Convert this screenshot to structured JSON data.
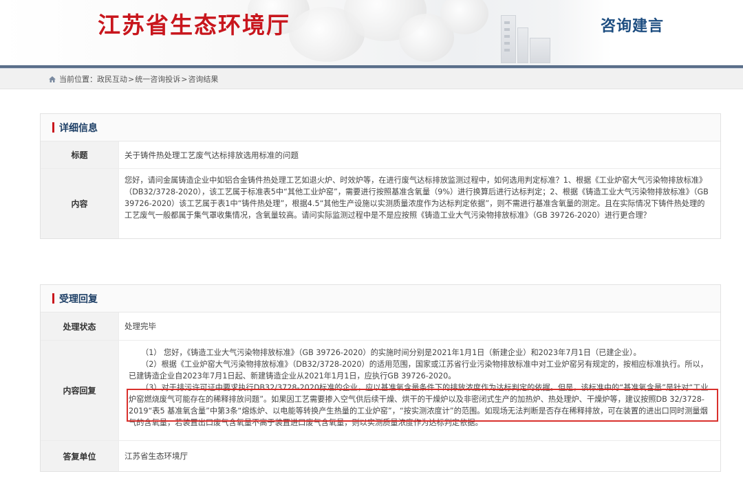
{
  "header": {
    "site_title": "江苏省生态环境厅",
    "section_name": "咨询建言"
  },
  "breadcrumb": {
    "prefix": "当前位置：",
    "items": [
      "政民互动",
      "统一咨询投诉",
      "咨询结果"
    ],
    "separator": ">"
  },
  "details": {
    "heading": "详细信息",
    "title_label": "标题",
    "title_value": "关于铸件热处理工艺废气达标排放选用标准的问题",
    "content_label": "内容",
    "content_value": "您好，请问金属铸造企业中如铝合金铸件热处理工艺如退火炉、时效炉等，在进行废气达标排放监测过程中，如何选用判定标准？1、根据《工业炉窑大气污染物排放标准》（DB32/3728-2020），该工艺属于标准表5中“其他工业炉窑”，需要进行按照基准含氧量（9%）进行换算后进行达标判定；2、根据《铸造工业大气污染物排放标准》（GB 39726-2020）该工艺属于表1中“铸件热处理”，根据4.5“其他生产设施以实测质量浓度作为达标判定依据”，则不需进行基准含氧量的测定。且在实际情况下铸件热处理的工艺废气一般都属于集气罩收集情况，含氧量较高。请问实际监测过程中是不是应按照《铸造工业大气污染物排放标准》（GB 39726-2020）进行更合理？"
  },
  "reply": {
    "heading": "受理回复",
    "status_label": "处理状态",
    "status_value": "处理完毕",
    "content_label": "内容回复",
    "paragraphs": [
      "（1） 您好，《铸造工业大气污染物排放标准》（GB 39726-2020）的实施时间分别是2021年1月1日（新建企业）和2023年7月1日（已建企业）。",
      "（2）根据《工业炉窑大气污染物排放标准》（DB32/3728-2020）的适用范围，国家或江苏省行业污染物排放标准中对工业炉窑另有规定的，按相应标准执行。所以，已建铸造企业自2023年7月1日起、新建铸造企业从2021年1月1日，应执行GB 39726-2020。",
      "（3）对于排污许可证中要求执行DB32/3728-2020标准的企业，应以基准氧含量条件下的排放浓度作为达标判定的依据。但是，该标准中的“基准氧含量”是针对“工业炉窑燃烧废气可能存在的稀释排放问题”。如果因工艺需要掺入空气供后续干燥、烘干的干燥炉以及非密闭式生产的加热炉、热处理炉、干燥炉等，建议按照DB 32/3728-2019“表5 基准氧含量”中第3条“熔炼炉、以电能等转换产生热量的工业炉窑”，“按实测浓度计”的范围。如现场无法判断是否存在稀释排放，可在装置的进出口同时测量烟气的含氧量，若装置出口废气含氧量不高于装置进口废气含氧量，则以实测质量浓度作为达标判定依据。"
    ],
    "unit_label": "答复单位",
    "unit_value": "江苏省生态环境厅"
  },
  "colors": {
    "brand_red": "#c8161d",
    "nav_blue": "#1d3f66",
    "highlight_red": "#d9302c"
  }
}
